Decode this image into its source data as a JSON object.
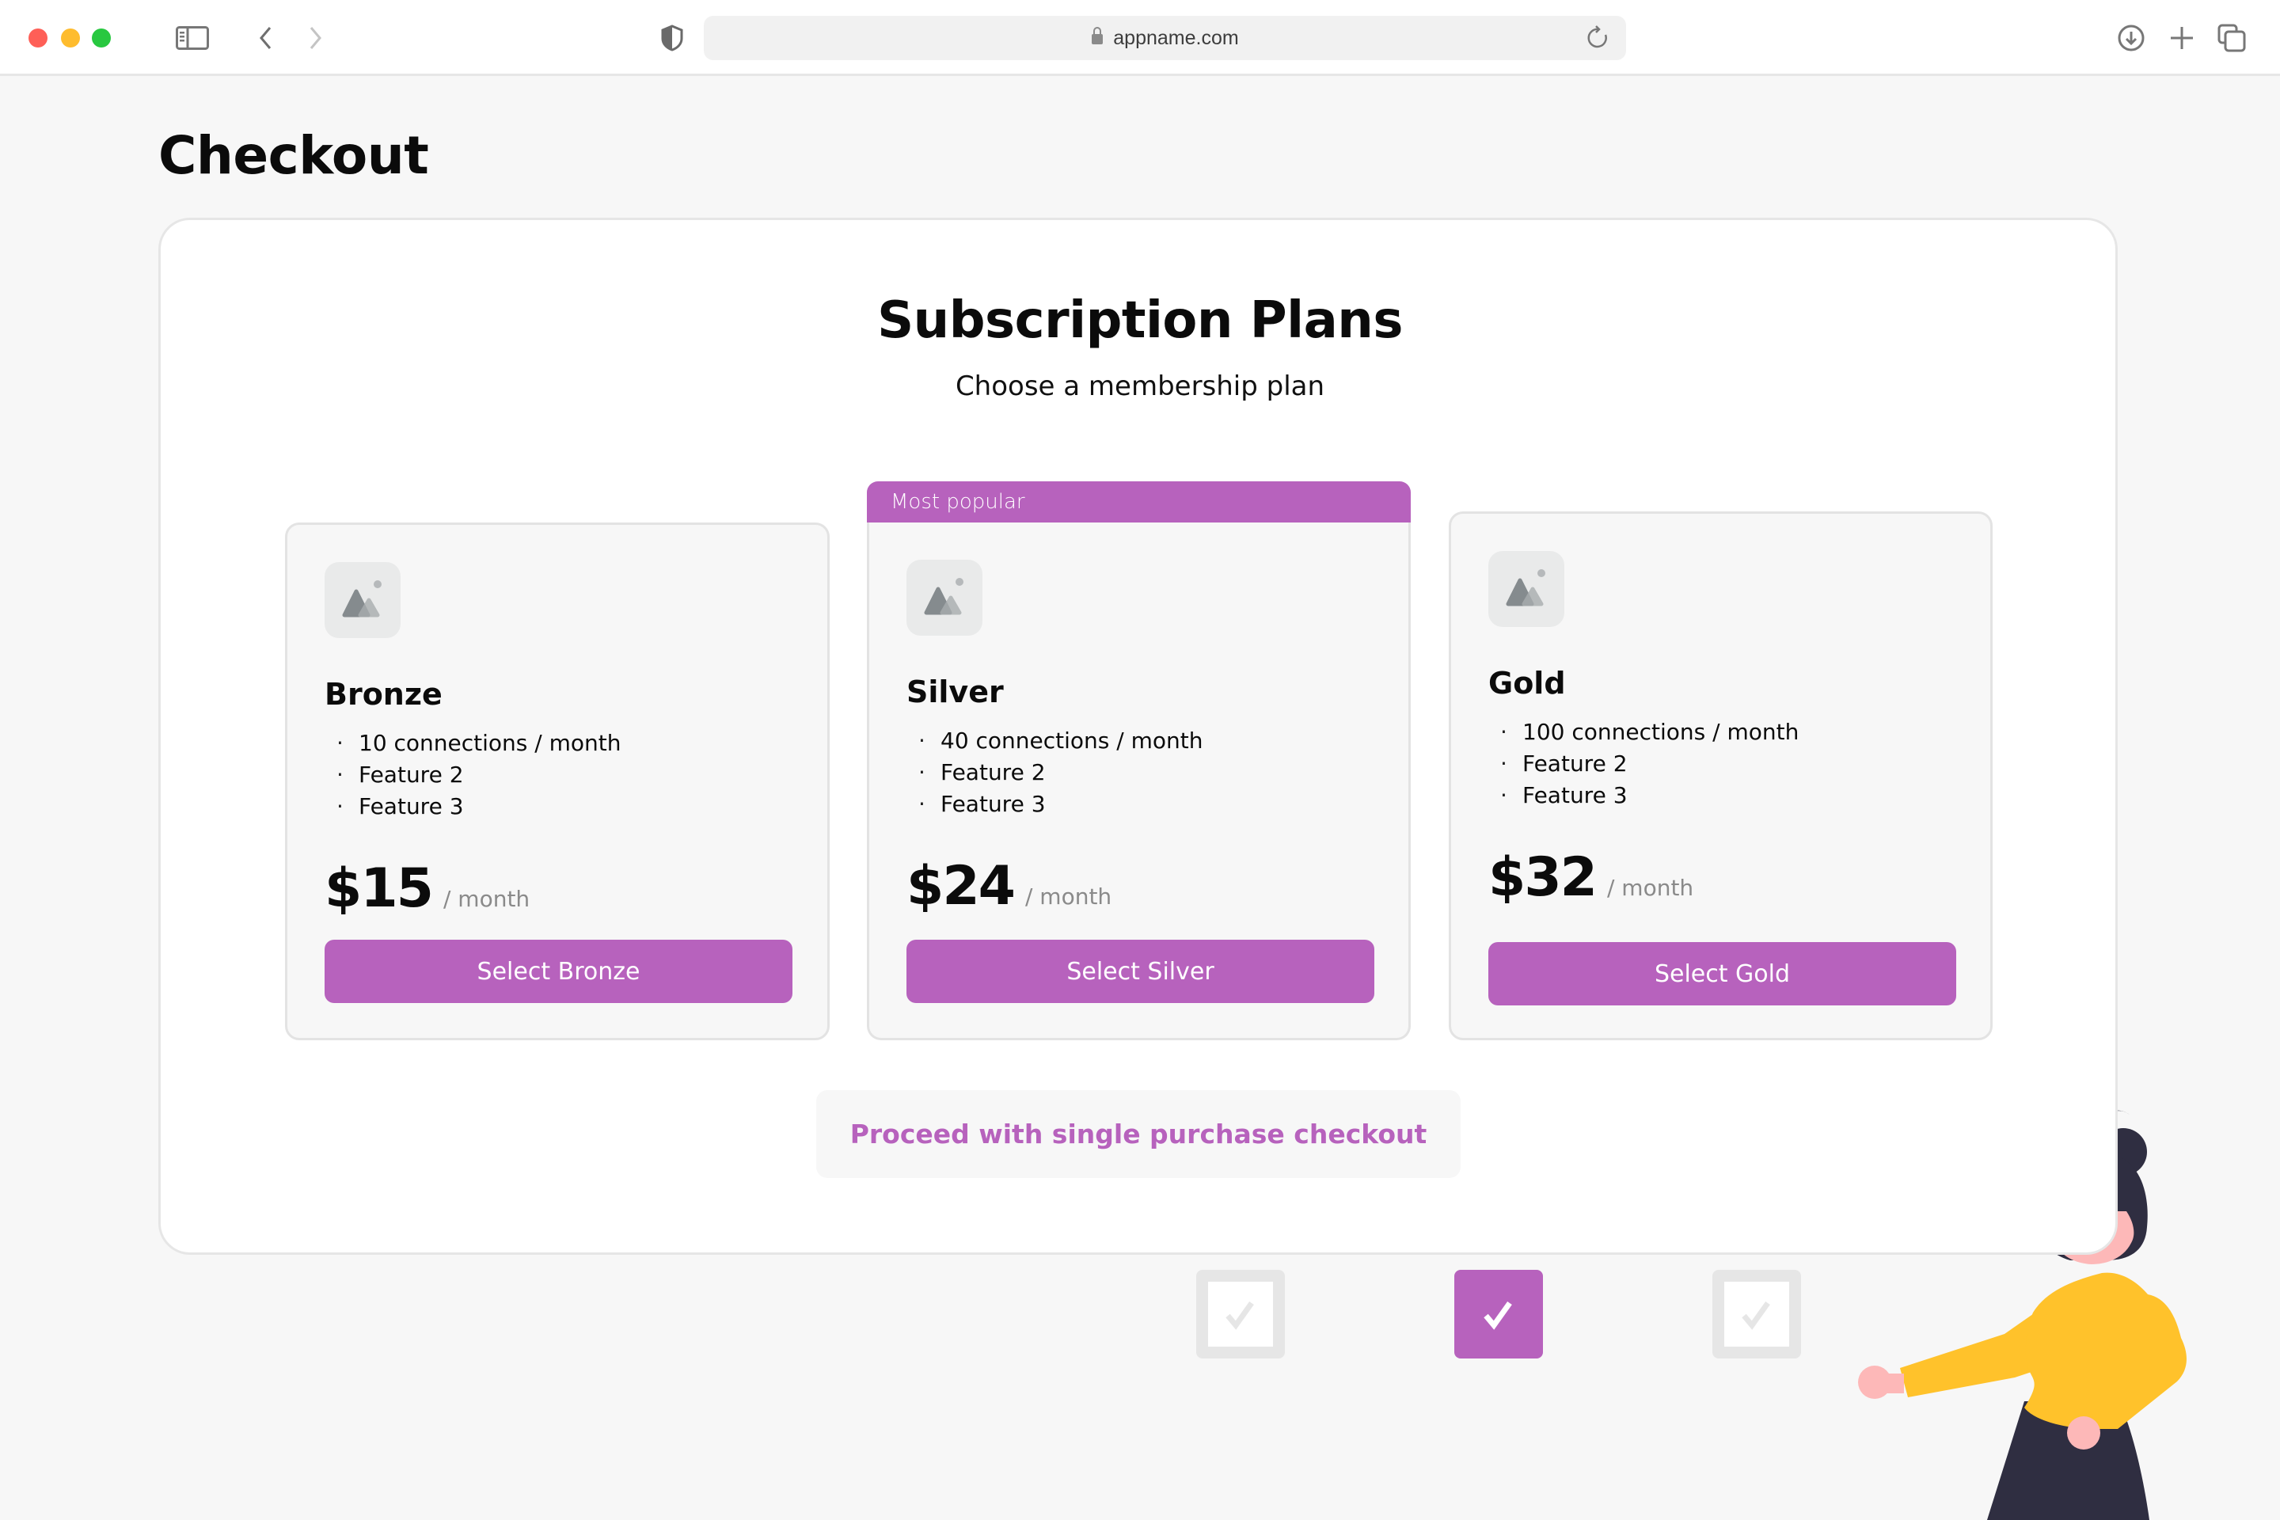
{
  "browser": {
    "url": "appname.com",
    "icons": [
      "sidebar-icon",
      "back-icon",
      "forward-icon",
      "shield-icon",
      "lock-icon",
      "reload-icon",
      "download-icon",
      "new-tab-icon",
      "tabs-overview-icon"
    ]
  },
  "page": {
    "title": "Checkout"
  },
  "plans_section": {
    "title": "Subscription Plans",
    "subtitle": "Choose a membership plan",
    "popular_badge": "Most popular",
    "plans": [
      {
        "name": "Bronze",
        "features": [
          "10 connections / month",
          "Feature 2",
          "Feature 3"
        ],
        "price": "$15",
        "period": "/ month",
        "button_label": "Select Bronze"
      },
      {
        "name": "Silver",
        "features": [
          "40 connections / month",
          "Feature 2",
          "Feature 3"
        ],
        "price": "$24",
        "period": "/ month",
        "button_label": "Select Silver"
      },
      {
        "name": "Gold",
        "features": [
          "100 connections / month",
          "Feature 2",
          "Feature 3"
        ],
        "price": "$32",
        "period": "/ month",
        "button_label": "Select Gold"
      }
    ],
    "bullet": "·",
    "proceed_label": "Proceed with single purchase checkout"
  },
  "illustration": {
    "checkboxes": [
      {
        "checked": false
      },
      {
        "checked": true
      },
      {
        "checked": false
      }
    ]
  },
  "colors": {
    "accent": "#b762bd",
    "background": "#f7f7f7",
    "card": "#ffffff",
    "shirt": "#ffc22b",
    "hair": "#2f2e41",
    "skin": "#fdb8b8"
  }
}
